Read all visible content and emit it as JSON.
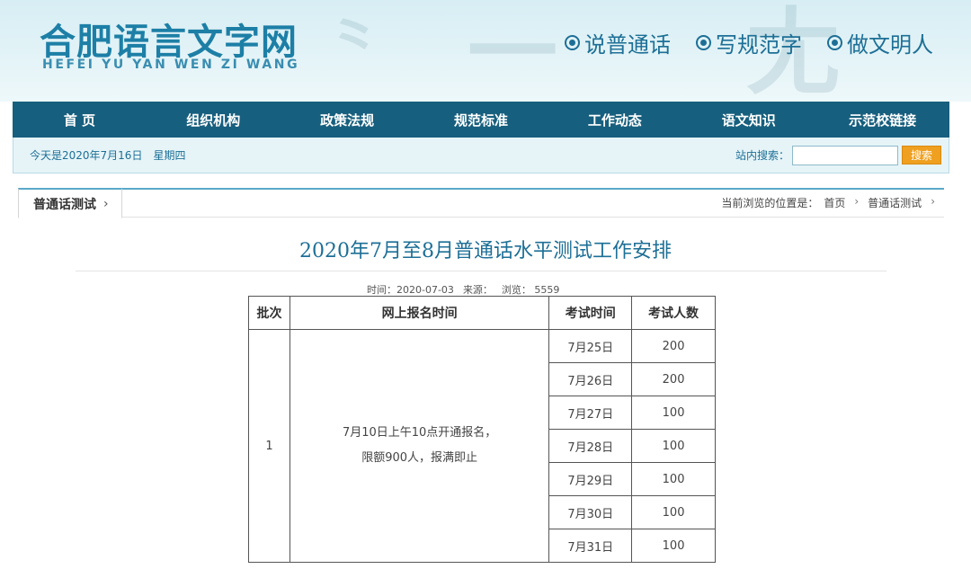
{
  "header": {
    "logo_cn": "合肥语言文字网",
    "logo_en": "HEFEI YU YAN WEN ZI WANG",
    "slogans": [
      "说普通话",
      "写规范字",
      "做文明人"
    ]
  },
  "nav": [
    "首 页",
    "组织机构",
    "政策法规",
    "规范标准",
    "工作动态",
    "语文知识",
    "示范校链接"
  ],
  "infobar": {
    "date": "今天是2020年7月16日",
    "weekday": "星期四",
    "search_label": "站内搜索：",
    "search_value": "",
    "search_button": "搜索"
  },
  "breadcrumb": {
    "tab": "普通话测试",
    "chevron": "›",
    "location_label": "当前浏览的位置是：",
    "items": [
      "首页",
      "普通话测试"
    ]
  },
  "article": {
    "title": "2020年7月至8月普通话水平测试工作安排",
    "meta": {
      "time": "时间：2020-07-03",
      "source": "来源：",
      "views": "浏览： 5559"
    },
    "table": {
      "headers": [
        "批次",
        "网上报名时间",
        "考试时间",
        "考试人数"
      ],
      "batch": "1",
      "note_line1": "7月10日上午10点开通报名，",
      "note_line2": "限额900人，报满即止",
      "rows": [
        {
          "date": "7月25日",
          "count": "200"
        },
        {
          "date": "7月26日",
          "count": "200"
        },
        {
          "date": "7月27日",
          "count": "100"
        },
        {
          "date": "7月28日",
          "count": "100"
        },
        {
          "date": "7月29日",
          "count": "100"
        },
        {
          "date": "7月30日",
          "count": "100"
        },
        {
          "date": "7月31日",
          "count": "100"
        }
      ]
    }
  },
  "colors": {
    "brand": "#1d7fa6",
    "nav_bg": "#175f7e",
    "search_button": "#f0a020"
  }
}
